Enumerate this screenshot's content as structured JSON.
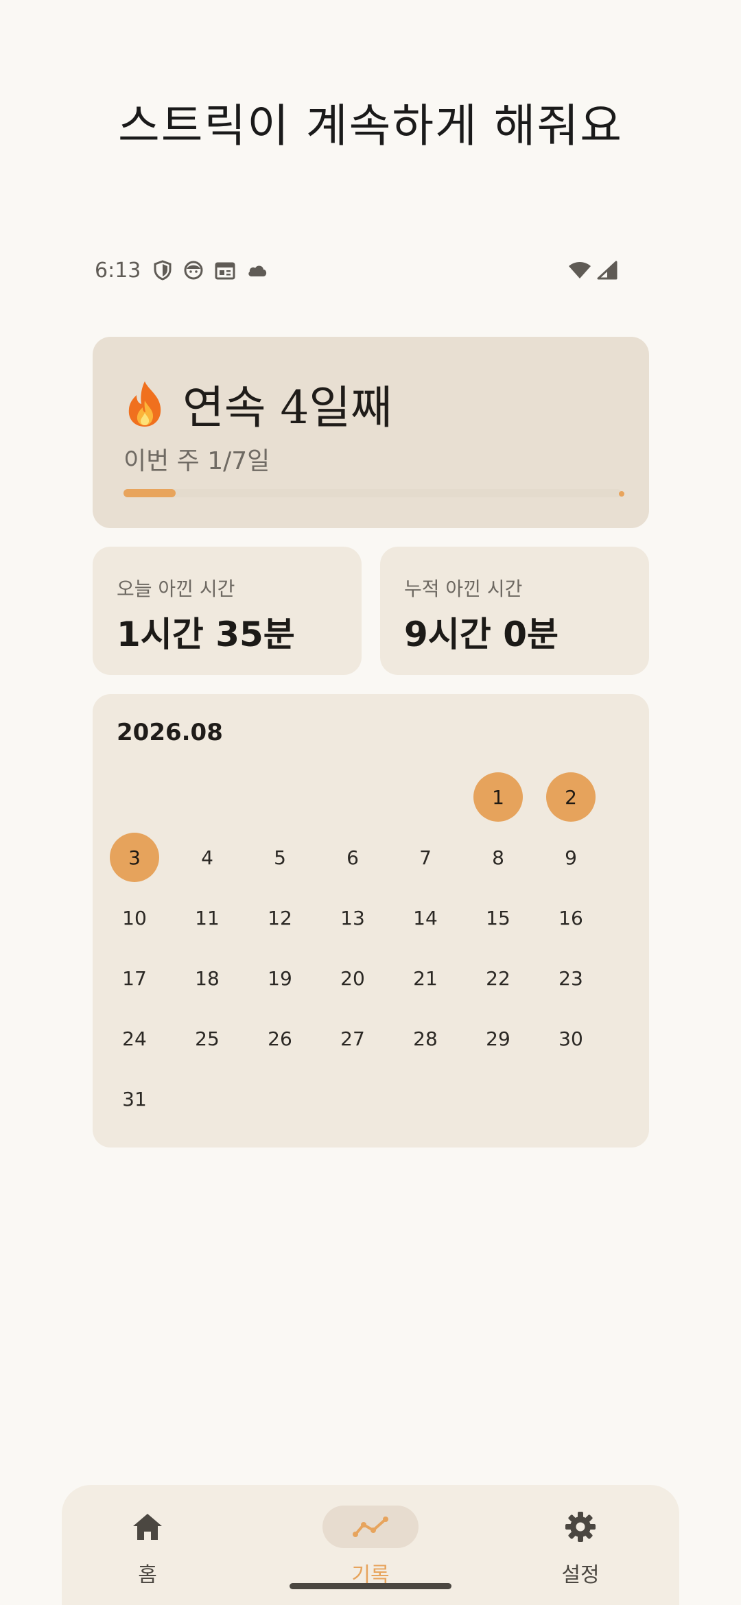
{
  "headline": "스트릭이 계속하게 해줘요",
  "status_bar": {
    "time": "6:13",
    "left_icons": [
      "shield-icon",
      "face-icon",
      "calendar-widget-icon",
      "cloud-icon"
    ],
    "right_icons": [
      "wifi-icon",
      "signal-icon"
    ]
  },
  "streak": {
    "title": "연속 4일째",
    "subtitle": "이번 주 1/7일",
    "week_progress_fraction": 0.1429,
    "accent_color": "#e8a45c"
  },
  "stats": {
    "today_label": "오늘 아낀 시간",
    "today_value": "1시간 35분",
    "total_label": "누적 아낀 시간",
    "total_value": "9시간 0분"
  },
  "calendar": {
    "month": "2026.08",
    "leading_blanks": 5,
    "days": [
      "1",
      "2",
      "3",
      "4",
      "5",
      "6",
      "7",
      "8",
      "9",
      "10",
      "11",
      "12",
      "13",
      "14",
      "15",
      "16",
      "17",
      "18",
      "19",
      "20",
      "21",
      "22",
      "23",
      "24",
      "25",
      "26",
      "27",
      "28",
      "29",
      "30",
      "31"
    ],
    "active_days": [
      "1",
      "2",
      "3"
    ],
    "active_color": "#e6a35c"
  },
  "nav": {
    "home_label": "홈",
    "records_label": "기록",
    "settings_label": "설정",
    "selected": "records"
  }
}
